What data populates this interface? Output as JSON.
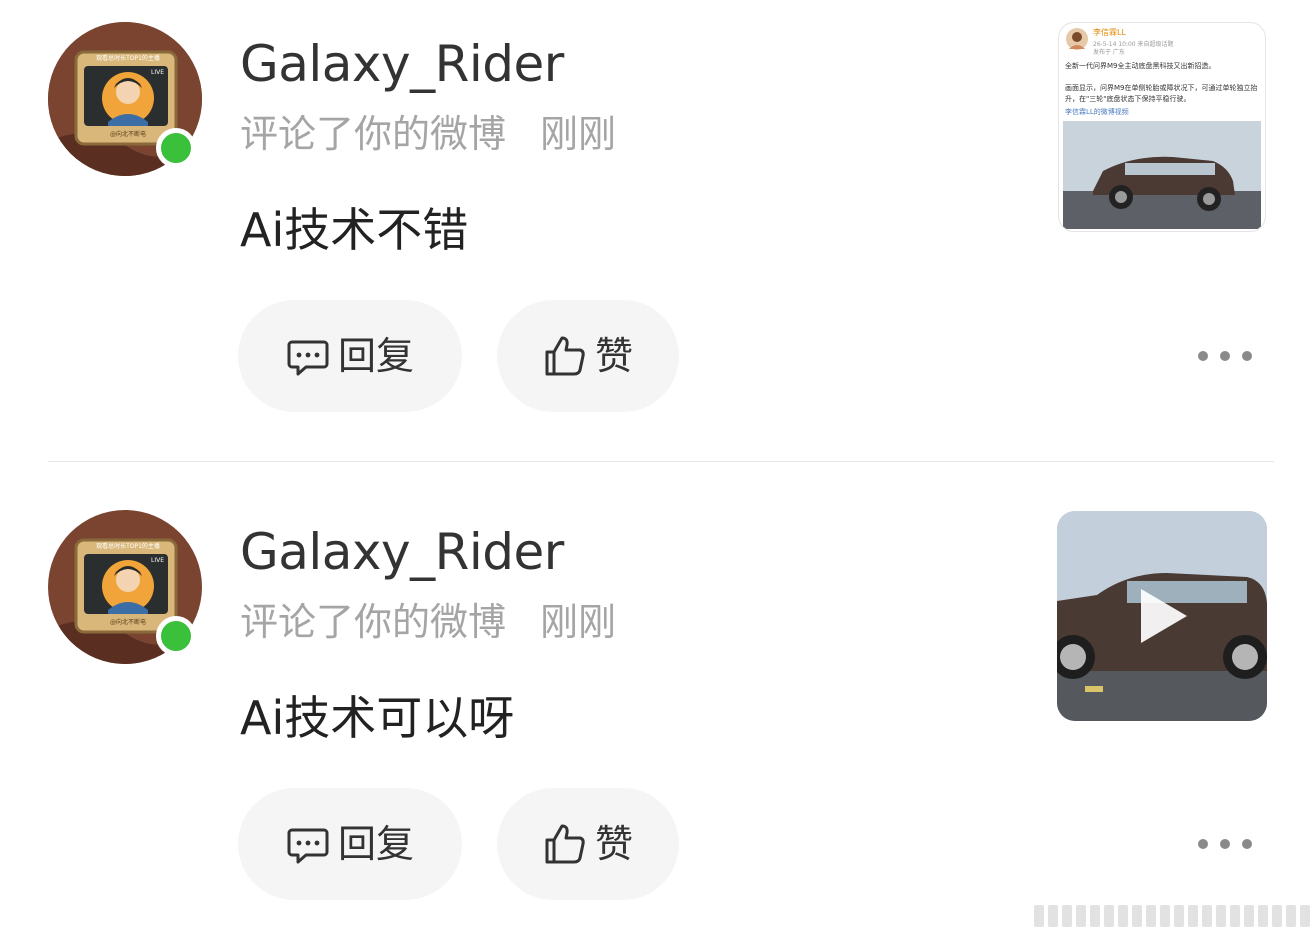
{
  "notifications": [
    {
      "username": "Galaxy_Rider",
      "action": "评论了你的微博",
      "time": "刚刚",
      "comment": "Ai技术不错",
      "reply_label": "回复",
      "like_label": "赞",
      "online": true,
      "thumbnail": {
        "type": "post",
        "author": "李信霖LL",
        "date": "26-5-14 10:00",
        "source": "来自超级话题",
        "location": "发布于 广东",
        "line1": "全新一代问界M9全主动底盘黑科技又出新招造。",
        "line2": "画面显示，问界M9在单侧轮胎或障状况下，可通过单轮独立抬升，在\"三轮\"底盘状态下保持平稳行驶。",
        "line3": "李信霖LL的微博视频"
      }
    },
    {
      "username": "Galaxy_Rider",
      "action": "评论了你的微博",
      "time": "刚刚",
      "comment": "Ai技术可以呀",
      "reply_label": "回复",
      "like_label": "赞",
      "online": true,
      "thumbnail": {
        "type": "video"
      }
    }
  ],
  "avatar_banner": "观看总时长TOP1的主播",
  "avatar_live": "LIVE",
  "avatar_caption": "@向北不断电",
  "colors": {
    "online": "#3ac03a",
    "button_bg": "#f5f5f5",
    "meta_text": "#a5a5a5"
  }
}
